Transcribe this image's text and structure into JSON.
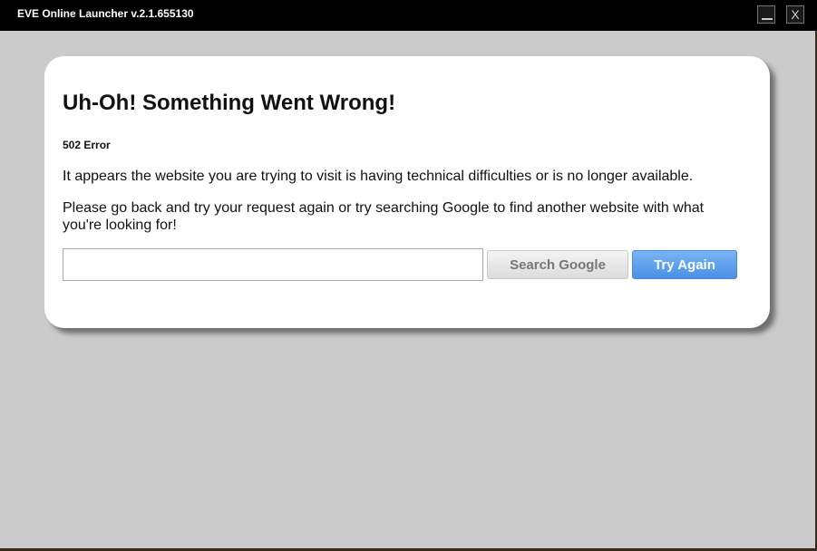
{
  "window": {
    "title": "EVE Online Launcher v.2.1.655130",
    "minimize_icon": "minimize-icon",
    "close_label": "X"
  },
  "error_page": {
    "heading": "Uh-Oh! Something Went Wrong!",
    "error_code": "502 Error",
    "message_1": "It appears the website you are trying to visit is having technical difficulties or is no longer available.",
    "message_2": "Please go back and try your request again or try searching Google to find another website with what you're looking for!",
    "search_value": "",
    "search_button_label": "Search Google",
    "try_again_label": "Try Again"
  },
  "colors": {
    "titlebar": "#000000",
    "background": "#cbcbcb",
    "card": "#ffffff",
    "accent": "#4a90e6"
  }
}
